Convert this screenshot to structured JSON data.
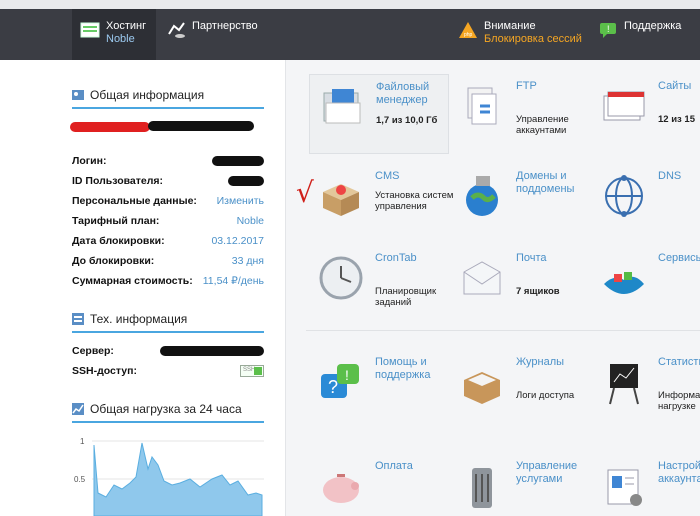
{
  "header": {
    "hosting": {
      "title": "Хостинг",
      "sub": "Noble"
    },
    "partner": {
      "title": "Партнерство"
    },
    "alert": {
      "title": "Внимание",
      "sub": "Блокировка сессий"
    },
    "support": {
      "title": "Поддержка"
    }
  },
  "general": {
    "title": "Общая информация",
    "rows": [
      {
        "label": "Логин:",
        "value": ""
      },
      {
        "label": "ID Пользователя:",
        "value": ""
      },
      {
        "label": "Персональные данные:",
        "value": "Изменить"
      },
      {
        "label": "Тарифный план:",
        "value": "Noble"
      },
      {
        "label": "Дата блокировки:",
        "value": "03.12.2017"
      },
      {
        "label": "До блокировки:",
        "value": "33 дня"
      },
      {
        "label": "Суммарная стоимость:",
        "value": "11,54 ₽/день"
      }
    ]
  },
  "tech": {
    "title": "Тех. информация",
    "server_label": "Сервер:",
    "ssh_label": "SSH-доступ:",
    "ssh_toggle": "SSH"
  },
  "load": {
    "title": "Общая нагрузка за 24 часа",
    "ticks": [
      "1",
      "0.5",
      "0"
    ]
  },
  "services": [
    {
      "title": "Файловый менеджер",
      "desc": "1,7 из 10,0 Гб",
      "icon": "file-manager-icon"
    },
    {
      "title": "FTP",
      "desc": "Управление аккаунтами",
      "icon": "ftp-icon"
    },
    {
      "title": "Сайты",
      "desc": "12 из 15",
      "icon": "sites-icon"
    },
    {
      "title": "CMS",
      "desc": "Установка систем управления",
      "icon": "cms-icon"
    },
    {
      "title": "Домены и поддомены",
      "desc": "",
      "icon": "domains-icon"
    },
    {
      "title": "DNS",
      "desc": "",
      "icon": "dns-icon"
    },
    {
      "title": "CronTab",
      "desc": "Планировщик заданий",
      "icon": "clock-icon"
    },
    {
      "title": "Почта",
      "desc": "7 ящиков",
      "icon": "mail-icon"
    },
    {
      "title": "Сервисы",
      "desc": "",
      "icon": "services-icon"
    },
    {
      "title": "Помощь и поддержка",
      "desc": "",
      "icon": "help-icon"
    },
    {
      "title": "Журналы",
      "desc": "Логи доступа",
      "icon": "logs-icon"
    },
    {
      "title": "Статистика",
      "desc": "Информация о нагрузке",
      "icon": "stats-icon"
    },
    {
      "title": "Оплата",
      "desc": "",
      "icon": "piggy-bank-icon"
    },
    {
      "title": "Управление услугами",
      "desc": "",
      "icon": "server-icon"
    },
    {
      "title": "Настройки аккаунта",
      "desc": "",
      "icon": "account-settings-icon"
    }
  ],
  "colors": {
    "accent": "#4a90c8",
    "header_bg": "#3b3d44",
    "alert": "#f5a623"
  }
}
